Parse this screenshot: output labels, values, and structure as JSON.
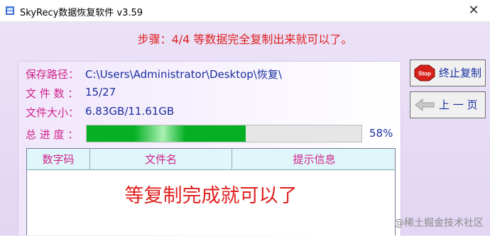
{
  "window": {
    "title": "SkyRecy数据恢复软件 v3.59",
    "close_glyph": "✕"
  },
  "step_text": "步骤：4/4 等数据完全复制出来就可以了。",
  "info": {
    "save_path_label": "保存路径：",
    "save_path_value": "C:\\Users\\Administrator\\Desktop\\恢复\\",
    "file_count_label": "文 件 数 ：",
    "file_count_value": "15/27",
    "file_size_label": "文件大小：",
    "file_size_value": "6.83GB/11.61GB",
    "progress_label": "总 进 度 ：",
    "progress_value": 0.58,
    "progress_text": "58%"
  },
  "table": {
    "headers": [
      "数字码",
      "文件名",
      "提示信息"
    ],
    "message": "等复制完成就可以了"
  },
  "buttons": {
    "stop_label": "终止复制",
    "stop_icon_text": "Stop",
    "prev_label": "上 一 页"
  },
  "watermark": "@稀土掘金技术社区",
  "colors": {
    "accent_text": "#e0201f",
    "label": "#d0228a",
    "value": "#1a2fa0",
    "progress": "#06b025"
  }
}
